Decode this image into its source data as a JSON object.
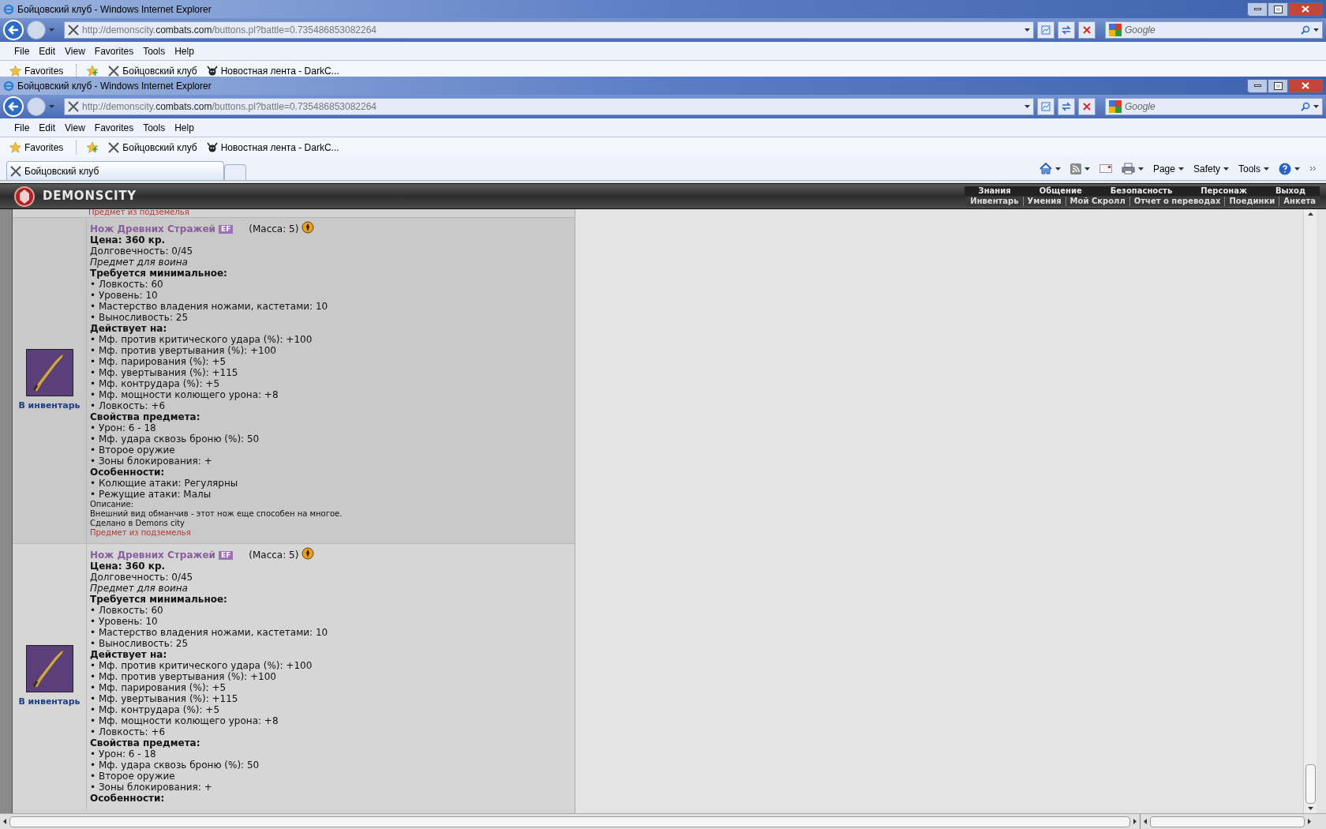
{
  "windows": [
    {
      "title": "Бойцовский клуб - Windows Internet Explorer",
      "address": {
        "prefix": "http://demonscity.",
        "domain": "combats.com",
        "path": "/buttons.pl?battle=0.735486853082264"
      },
      "search": {
        "placeholder": "Google"
      },
      "menu": [
        "File",
        "Edit",
        "View",
        "Favorites",
        "Tools",
        "Help"
      ],
      "favorites": {
        "label": "Favorites",
        "links": [
          "Бойцовский клуб",
          "Новостная лента - DarkC..."
        ]
      }
    },
    {
      "title": "Бойцовский клуб - Windows Internet Explorer",
      "address": {
        "prefix": "http://demonscity.",
        "domain": "combats.com",
        "path": "/buttons.pl?battle=0.735486853082264"
      },
      "search": {
        "placeholder": "Google"
      },
      "menu": [
        "File",
        "Edit",
        "View",
        "Favorites",
        "Tools",
        "Help"
      ],
      "favorites": {
        "label": "Favorites",
        "links": [
          "Бойцовский клуб",
          "Новостная лента - DarkC..."
        ]
      },
      "tabs": [
        {
          "label": "Бойцовский клуб",
          "selected": true
        }
      ],
      "command_bar": [
        "Page",
        "Safety",
        "Tools"
      ]
    }
  ],
  "site": {
    "logo": "DEMONSCITY",
    "menu_top": [
      "Знания",
      "Общение",
      "Безопасность",
      "Персонаж",
      "Выход"
    ],
    "menu_bottom": [
      "Инвентарь",
      "Умения",
      "Мой Скролл",
      "Отчет о переводах",
      "Поединки",
      "Анкета"
    ]
  },
  "previous_item_tail": "Предмет из подземелья",
  "items": [
    {
      "name": "Нож Древних Стражей",
      "badge": "EF",
      "mass": "(Масса: 5)",
      "price": "Цена: 360 кр.",
      "durability": "Долговечность: 0/45",
      "class_note": "Предмет для воина",
      "link": "В инвентарь",
      "sections": [
        {
          "heading": "Требуется минимальное:",
          "lines": [
            "• Ловкость: 60",
            "• Уровень: 10",
            "• Мастерство владения ножами, кастетами: 10",
            "• Выносливость: 25"
          ]
        },
        {
          "heading": "Действует на:",
          "lines": [
            "• Мф. против критического удара (%): +100",
            "• Мф. против увертывания (%): +100",
            "• Мф. парирования (%): +5",
            "• Мф. увертывания (%): +115",
            "• Мф. контрудара (%): +5",
            "• Мф. мощности колющего урона: +8",
            "• Ловкость: +6"
          ]
        },
        {
          "heading": "Свойства предмета:",
          "lines": [
            "• Урон: 6 - 18",
            "• Мф. удара сквозь броню (%): 50",
            "• Второе оружие",
            "• Зоны блокирования: +"
          ]
        },
        {
          "heading": "Особенности:",
          "lines": [
            "• Колющие атаки: Регулярны",
            "• Режущие атаки: Малы"
          ]
        }
      ],
      "description_label": "Описание:",
      "description": "Внешний вид обманчив - этот нож еще способен на многое.",
      "made_by": "Сделано в Demons city",
      "origin": "Предмет из подземелья"
    },
    {
      "name": "Нож Древних Стражей",
      "badge": "EF",
      "mass": "(Масса: 5)",
      "price": "Цена: 360 кр.",
      "durability": "Долговечность: 0/45",
      "class_note": "Предмет для воина",
      "link": "В инвентарь",
      "sections": [
        {
          "heading": "Требуется минимальное:",
          "lines": [
            "• Ловкость: 60",
            "• Уровень: 10",
            "• Мастерство владения ножами, кастетами: 10",
            "• Выносливость: 25"
          ]
        },
        {
          "heading": "Действует на:",
          "lines": [
            "• Мф. против критического удара (%): +100",
            "• Мф. против увертывания (%): +100",
            "• Мф. парирования (%): +5",
            "• Мф. увертывания (%): +115",
            "• Мф. контрудара (%): +5",
            "• Мф. мощности колющего урона: +8",
            "• Ловкость: +6"
          ]
        },
        {
          "heading": "Свойства предмета:",
          "lines": [
            "• Урон: 6 - 18",
            "• Мф. удара сквозь броню (%): 50",
            "• Второе оружие",
            "• Зоны блокирования: +"
          ]
        },
        {
          "heading": "Особенности:"
        }
      ]
    }
  ]
}
